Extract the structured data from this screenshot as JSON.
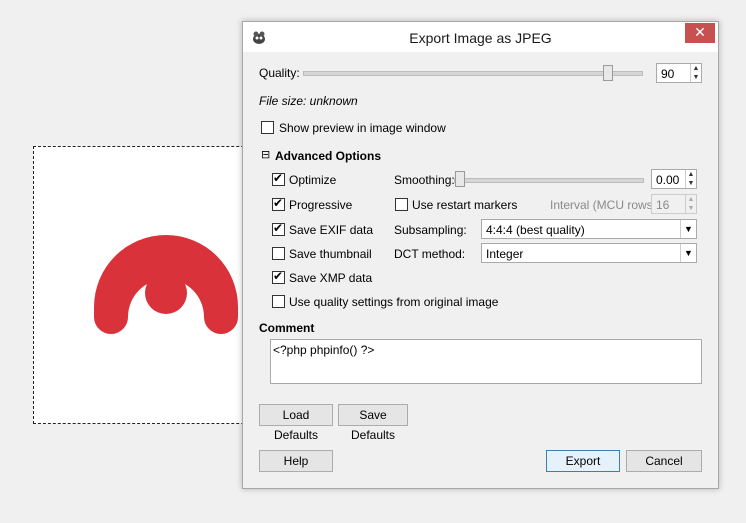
{
  "dialog": {
    "title": "Export Image as JPEG",
    "close_label": "✕"
  },
  "quality": {
    "label": "Quality:",
    "value": "90",
    "slider_fraction": 0.9
  },
  "file_size": "File size: unknown",
  "show_preview": {
    "label": "Show preview in image window",
    "checked": false
  },
  "advanced": {
    "toggle": "⊟",
    "label": "Advanced Options",
    "optimize": {
      "label": "Optimize",
      "checked": true
    },
    "progressive": {
      "label": "Progressive",
      "checked": true
    },
    "save_exif": {
      "label": "Save EXIF data",
      "checked": true
    },
    "save_thumbnail": {
      "label": "Save thumbnail",
      "checked": false
    },
    "save_xmp": {
      "label": "Save XMP data",
      "checked": true
    },
    "use_quality_original": {
      "label": "Use quality settings from original image",
      "checked": false
    },
    "smoothing": {
      "label": "Smoothing:",
      "value": "0.00",
      "slider_fraction": 0.0
    },
    "restart_markers": {
      "label": "Use restart markers",
      "checked": false
    },
    "interval": {
      "label": "Interval (MCU rows):",
      "value": "16"
    },
    "subsampling": {
      "label": "Subsampling:",
      "value": "4:4:4 (best quality)"
    },
    "dct": {
      "label": "DCT method:",
      "value": "Integer"
    }
  },
  "comment": {
    "label": "Comment",
    "value": "<?php phpinfo() ?>"
  },
  "buttons": {
    "load_defaults": "Load Defaults",
    "save_defaults": "Save Defaults",
    "help": "Help",
    "export": "Export",
    "cancel": "Cancel"
  },
  "colors": {
    "logo_red": "#d9323a",
    "close_red": "#c75050"
  },
  "icons": {
    "app": "gimp-wilber-icon",
    "check": "✔",
    "dropdown": "▼"
  }
}
